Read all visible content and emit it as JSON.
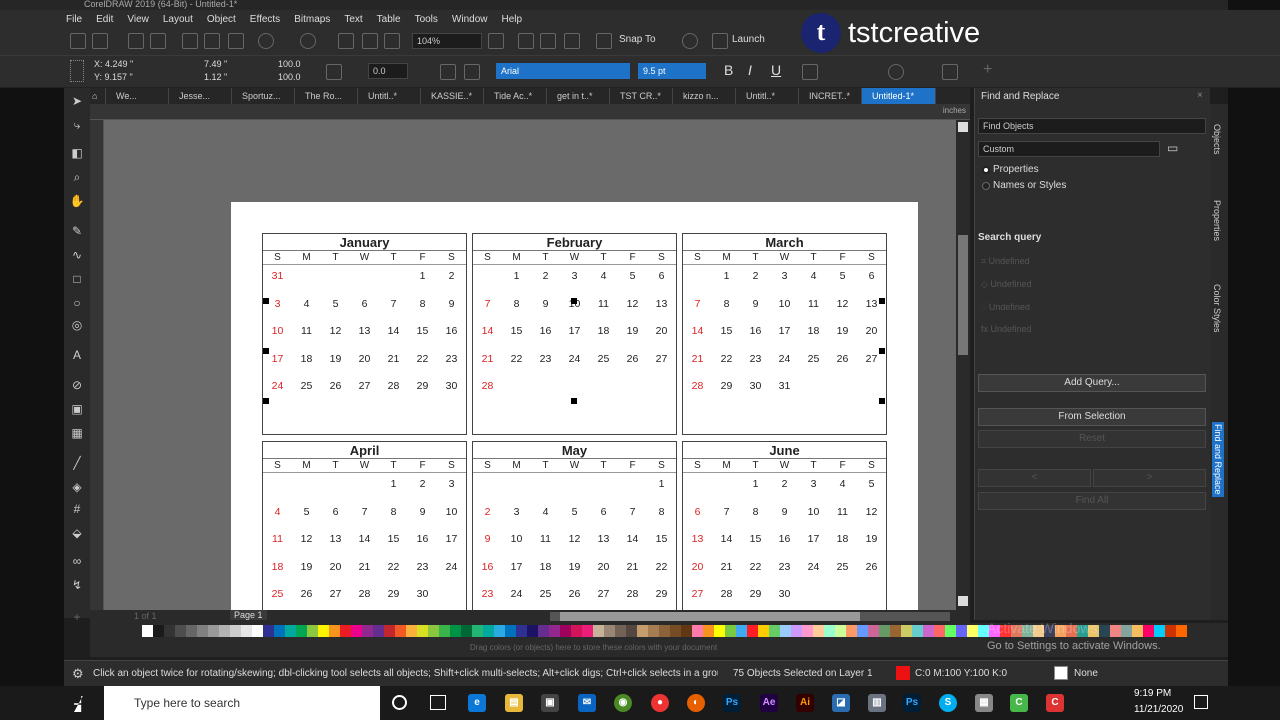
{
  "window_title": "CorelDRAW 2019 (64-Bit) - Untitled-1*",
  "menu": [
    "File",
    "Edit",
    "View",
    "Layout",
    "Object",
    "Effects",
    "Bitmaps",
    "Text",
    "Table",
    "Tools",
    "Window",
    "Help"
  ],
  "toolbar": {
    "zoom": "104%",
    "snap_to": "Snap To",
    "launch": "Launch",
    "brand": "tstcreative",
    "brand_letter": "t"
  },
  "property_bar": {
    "x": "X: 4.249 \"",
    "y": "Y: 9.157 \"",
    "w": "7.49 \"",
    "h": "1.12 \"",
    "scale_w": "100.0",
    "scale_h": "100.0",
    "pct": "%",
    "angle": "0.0",
    "font": "Arial",
    "font_size": "9.5 pt",
    "bold": "B",
    "italic": "I",
    "underline": "U"
  },
  "doc_tabs": [
    "We...",
    "Jesse...",
    "Sportuz...",
    "The Ro...",
    "Untitl..*",
    "KASSIE..*",
    "Tide Ac..*",
    "get in t..*",
    "TST CR..*",
    "kizzo n...",
    "Untitl..*",
    "INCRET..*",
    "Untitled-1*"
  ],
  "ruler_units": "inches",
  "page_label": "Page 1",
  "page_nav": "1 of 1",
  "days_of_week": [
    "S",
    "M",
    "T",
    "W",
    "T",
    "F",
    "S"
  ],
  "months": [
    {
      "name": "January",
      "days": [
        "31",
        "",
        "",
        "",
        "",
        "1",
        "2",
        "3",
        "4",
        "5",
        "6",
        "7",
        "8",
        "9",
        "10",
        "11",
        "12",
        "13",
        "14",
        "15",
        "16",
        "17",
        "18",
        "19",
        "20",
        "21",
        "22",
        "23",
        "24",
        "25",
        "26",
        "27",
        "28",
        "29",
        "30"
      ]
    },
    {
      "name": "February",
      "days": [
        "",
        "1",
        "2",
        "3",
        "4",
        "5",
        "6",
        "7",
        "8",
        "9",
        "10",
        "11",
        "12",
        "13",
        "14",
        "15",
        "16",
        "17",
        "18",
        "19",
        "20",
        "21",
        "22",
        "23",
        "24",
        "25",
        "26",
        "27",
        "28"
      ]
    },
    {
      "name": "March",
      "days": [
        "",
        "1",
        "2",
        "3",
        "4",
        "5",
        "6",
        "7",
        "8",
        "9",
        "10",
        "11",
        "12",
        "13",
        "14",
        "15",
        "16",
        "17",
        "18",
        "19",
        "20",
        "21",
        "22",
        "23",
        "24",
        "25",
        "26",
        "27",
        "28",
        "29",
        "30",
        "31"
      ]
    },
    {
      "name": "April",
      "days": [
        "",
        "",
        "",
        "",
        "1",
        "2",
        "3",
        "4",
        "5",
        "6",
        "7",
        "8",
        "9",
        "10",
        "11",
        "12",
        "13",
        "14",
        "15",
        "16",
        "17",
        "18",
        "19",
        "20",
        "21",
        "22",
        "23",
        "24",
        "25",
        "26",
        "27",
        "28",
        "29",
        "30"
      ]
    },
    {
      "name": "May",
      "days": [
        "",
        "",
        "",
        "",
        "",
        "",
        "1",
        "2",
        "3",
        "4",
        "5",
        "6",
        "7",
        "8",
        "9",
        "10",
        "11",
        "12",
        "13",
        "14",
        "15",
        "16",
        "17",
        "18",
        "19",
        "20",
        "21",
        "22",
        "23",
        "24",
        "25",
        "26",
        "27",
        "28",
        "29"
      ]
    },
    {
      "name": "June",
      "days": [
        "",
        "",
        "1",
        "2",
        "3",
        "4",
        "5",
        "6",
        "7",
        "8",
        "9",
        "10",
        "11",
        "12",
        "13",
        "14",
        "15",
        "16",
        "17",
        "18",
        "19",
        "20",
        "21",
        "22",
        "23",
        "24",
        "25",
        "26",
        "27",
        "28",
        "29",
        "30"
      ]
    }
  ],
  "docker": {
    "title": "Find and Replace",
    "find_type": "Find Objects",
    "preset": "Custom",
    "radio_properties": "Properties",
    "radio_names": "Names or Styles",
    "search_query": "Search query",
    "undefined": "Undefined",
    "add_query": "Add Query...",
    "from_selection": "From Selection",
    "reset": "Reset",
    "find_all": "Find All",
    "prev": "<",
    "next": ">"
  },
  "side_tabs": [
    "Objects",
    "Properties",
    "Color Styles",
    "Find and Replace"
  ],
  "palette_hint": "Drag colors (or objects) here to store these colors with your document",
  "palette_colors": [
    "#ffffff",
    "#1a1a1a",
    "#333333",
    "#4d4d4d",
    "#666666",
    "#808080",
    "#999999",
    "#b3b3b3",
    "#cccccc",
    "#e6e6e6",
    "#ffffff",
    "#2e3192",
    "#0071bc",
    "#00a99d",
    "#00a651",
    "#8dc63f",
    "#fff200",
    "#f7941d",
    "#ed1c24",
    "#ec008c",
    "#92278f",
    "#662d91",
    "#c1272d",
    "#f15a24",
    "#fbb03b",
    "#d9e021",
    "#8cc63f",
    "#39b54a",
    "#009245",
    "#006837",
    "#22b573",
    "#00a99d",
    "#29abe2",
    "#0071bc",
    "#2e3192",
    "#1b1464",
    "#662d91",
    "#93278f",
    "#9e005d",
    "#d4145a",
    "#ed1e79",
    "#c7b299",
    "#998675",
    "#736357",
    "#534741",
    "#c69c6d",
    "#a67c52",
    "#8c6239",
    "#754c24",
    "#603813",
    "#ff7bac",
    "#f7931e",
    "#ffff00",
    "#7ac943",
    "#3fa9f5",
    "#ff1d25",
    "#ffcc00",
    "#66cc66",
    "#99ccff",
    "#cc99ff",
    "#ff99cc",
    "#ffcc99",
    "#99ffcc",
    "#ccff99",
    "#ff9966",
    "#6699ff",
    "#cc6699",
    "#669966",
    "#996633",
    "#cccc66",
    "#66cccc",
    "#cc66cc",
    "#ff6666",
    "#66ff66",
    "#6666ff",
    "#ffff66",
    "#66ffff",
    "#ff66ff",
    "#ff3333",
    "#e07a5f",
    "#81b29a",
    "#f2cc8f",
    "#3d405b",
    "#f4a261",
    "#e76f51",
    "#2a9d8f",
    "#e9c46a",
    "#264653",
    "#f28482",
    "#84a59d",
    "#f6bd60",
    "#ff0066",
    "#00ccff",
    "#cc3300",
    "#ff6600"
  ],
  "status": {
    "hint": "Click an object twice for rotating/skewing; dbl-clicking tool selects all objects; Shift+click multi-selects; Alt+click digs; Ctrl+click selects in a group",
    "selection": "75 Objects Selected on Layer 1",
    "fill": "C:0 M:100 Y:100 K:0",
    "outline": "None",
    "fill_color": "#ee1111"
  },
  "activation": {
    "line1": "Activate Windows",
    "line2": "Go to Settings to activate Windows."
  },
  "taskbar": {
    "search": "Type here to search",
    "time": "9:19 PM",
    "date": "11/21/2020"
  }
}
